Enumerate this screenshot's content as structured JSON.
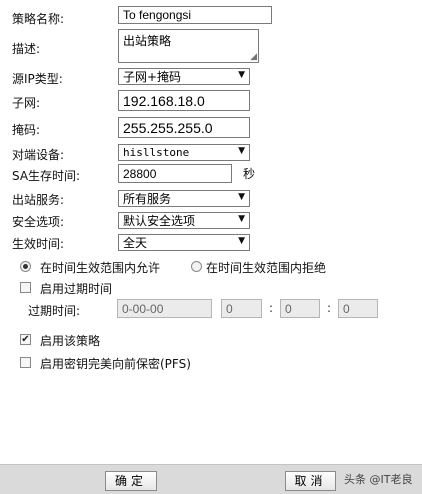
{
  "form": {
    "policy_name_label": "策略名称:",
    "policy_name_value": "To fengongsi",
    "description_label": "描述:",
    "description_value": "出站策略",
    "source_ip_type_label": "源IP类型:",
    "source_ip_type_value": "子网+掩码",
    "subnet_label": "子网:",
    "subnet_value": "192.168.18.0",
    "mask_label": "掩码:",
    "mask_value": "255.255.255.0",
    "peer_device_label": "对端设备:",
    "peer_device_value": "hisllstone",
    "sa_lifetime_label": "SA生存时间:",
    "sa_lifetime_value": "28800",
    "sa_lifetime_unit": "秒",
    "outbound_service_label": "出站服务:",
    "outbound_service_value": "所有服务",
    "security_option_label": "安全选项:",
    "security_option_value": "默认安全选项",
    "effective_time_label": "生效时间:",
    "effective_time_value": "全天"
  },
  "radios": {
    "allow_label": "在时间生效范围内允许",
    "allow_checked": true,
    "deny_label": "在时间生效范围内拒绝",
    "deny_checked": false
  },
  "expiry": {
    "enable_label": "启用过期时间",
    "enable_checked": false,
    "time_label": "过期时间:",
    "date_value": "0-00-00",
    "hour_value": "0",
    "minute_value": "0",
    "second_value": "0",
    "separator": ":"
  },
  "options": {
    "enable_policy_label": "启用该策略",
    "enable_policy_checked": true,
    "pfs_label": "启用密钥完美向前保密(PFS)",
    "pfs_checked": false
  },
  "buttons": {
    "ok_label": "确定",
    "cancel_label": "取消"
  },
  "watermark": "头条 @IT老良",
  "icons": {
    "dropdown": "chevron-down-icon",
    "resize": "resize-grip-icon",
    "check": "checkmark-icon"
  }
}
